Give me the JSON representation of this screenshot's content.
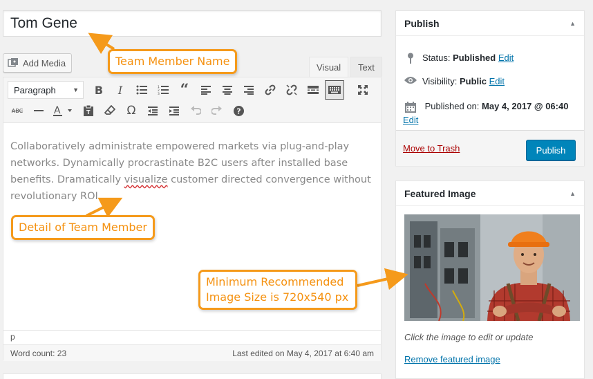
{
  "post": {
    "title": "Tom Gene"
  },
  "editor": {
    "add_media_label": "Add Media",
    "tabs": {
      "visual": "Visual",
      "text": "Text"
    },
    "format_select": "Paragraph",
    "content": {
      "part1": "Collaboratively administrate empowered markets via plug-and-play networks. Dynamically procrastinate B2C users after installed base benefits. Dramatically ",
      "misspelled": "visualize",
      "part2": " customer directed convergence without revolutionary ROI."
    },
    "path": "p",
    "word_count": "Word count: 23",
    "last_edited": "Last edited on May 4, 2017 at 6:40 am",
    "toolbar_icons": [
      "bold-icon",
      "italic-icon",
      "bullet-list-icon",
      "numbered-list-icon",
      "blockquote-icon",
      "align-left-icon",
      "align-center-icon",
      "align-right-icon",
      "link-icon",
      "unlink-icon",
      "read-more-icon",
      "toolbar-toggle-icon",
      "fullscreen-icon",
      "strikethrough-icon",
      "horizontal-line-icon",
      "text-color-icon",
      "paste-text-icon",
      "clear-formatting-icon",
      "special-character-icon",
      "outdent-icon",
      "indent-icon",
      "undo-icon",
      "redo-icon",
      "help-icon"
    ]
  },
  "publish": {
    "title": "Publish",
    "status_label": "Status:",
    "status_value": "Published",
    "visibility_label": "Visibility:",
    "visibility_value": "Public",
    "published_label": "Published on:",
    "published_value": "May 4, 2017 @ 06:40",
    "edit": "Edit",
    "trash": "Move to Trash",
    "button": "Publish"
  },
  "featured": {
    "title": "Featured Image",
    "caption": "Click the image to edit or update",
    "remove": "Remove featured image"
  },
  "callouts": {
    "name": "Team Member Name",
    "detail": "Detail of Team Member",
    "image_size_line1": "Minimum Recommended",
    "image_size_line2": "Image Size is 720x540 px"
  },
  "colors": {
    "accent": "#0085ba",
    "link": "#0073aa",
    "trash": "#aa0000",
    "callout": "#f59a1b"
  }
}
